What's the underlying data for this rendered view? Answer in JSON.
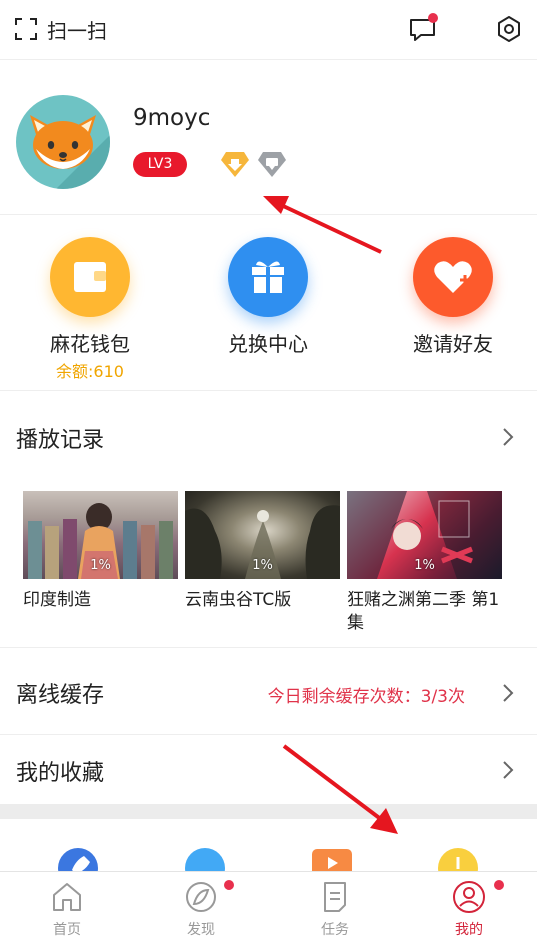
{
  "header": {
    "scan_label": "扫一扫"
  },
  "profile": {
    "username": "9moyc",
    "level": "LV3"
  },
  "actions": [
    {
      "label": "麻花钱包",
      "sub": "余额:610",
      "color": "#ffb731"
    },
    {
      "label": "兑换中心",
      "color": "#2f8ff0"
    },
    {
      "label": "邀请好友",
      "color": "#fd5a2c"
    }
  ],
  "history": {
    "title": "播放记录",
    "items": [
      {
        "title": "印度制造",
        "progress": "1%"
      },
      {
        "title": "云南虫谷TC版",
        "progress": "1%"
      },
      {
        "title": "狂赌之渊第二季 第1集",
        "progress": "1%"
      }
    ]
  },
  "offline": {
    "title": "离线缓存",
    "info": "今日剩余缓存次数：3/3次"
  },
  "favorites": {
    "title": "我的收藏"
  },
  "tabs": [
    {
      "label": "首页"
    },
    {
      "label": "发现"
    },
    {
      "label": "任务"
    },
    {
      "label": "我的"
    }
  ],
  "colors": {
    "accent": "#d3243a",
    "badge": "#e8192c",
    "notification": "#e8304d"
  }
}
